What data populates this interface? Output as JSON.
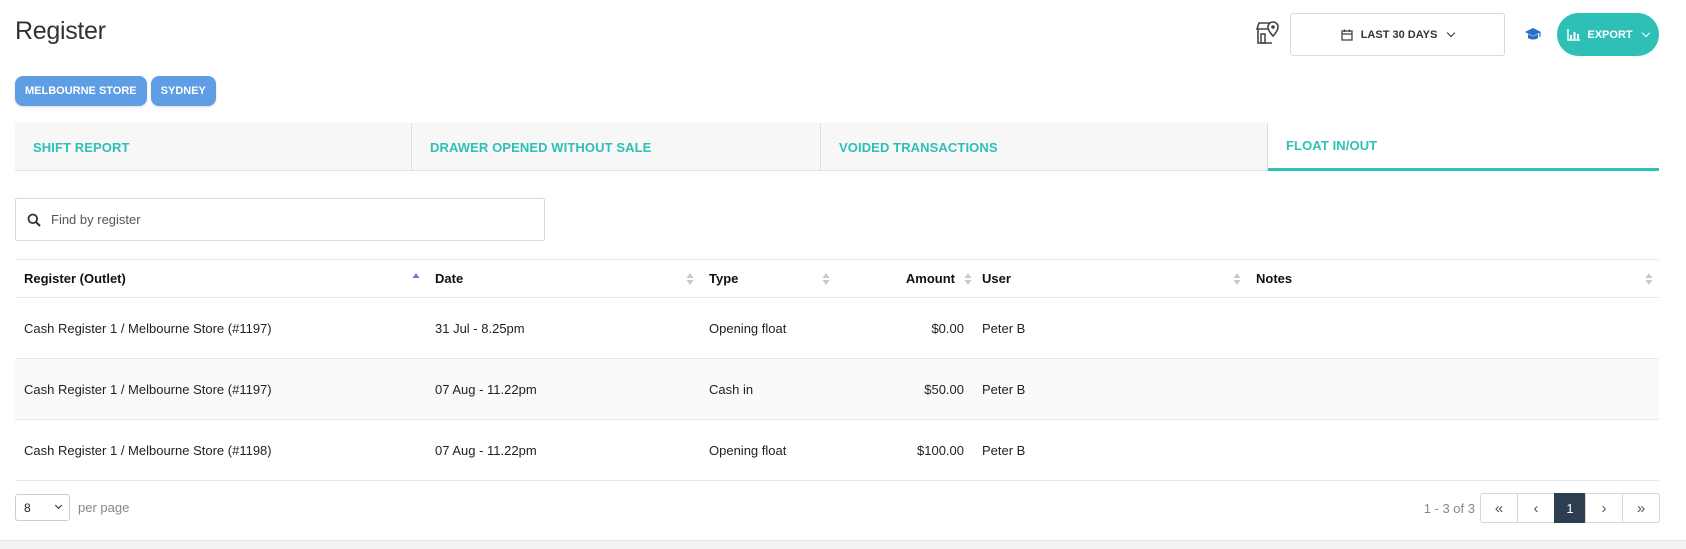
{
  "header": {
    "title": "Register",
    "date_range_label": "LAST 30 DAYS",
    "export_label": "EXPORT",
    "icons": [
      "store-location-icon",
      "calendar-icon",
      "graduation-cap-icon",
      "bar-chart-icon"
    ]
  },
  "outlet_filters": [
    "MELBOURNE STORE",
    "SYDNEY"
  ],
  "tabs": [
    {
      "label": "SHIFT REPORT",
      "active": false
    },
    {
      "label": "DRAWER OPENED WITHOUT SALE",
      "active": false
    },
    {
      "label": "VOIDED TRANSACTIONS",
      "active": false
    },
    {
      "label": "FLOAT IN/OUT",
      "active": true
    }
  ],
  "search": {
    "placeholder": "Find by register",
    "value": ""
  },
  "table": {
    "columns": [
      "Register (Outlet)",
      "Date",
      "Type",
      "Amount",
      "User",
      "Notes"
    ],
    "sorted_column": "Register (Outlet)",
    "sort_direction": "ascending",
    "rows": [
      {
        "register": "Cash Register 1 / Melbourne Store (#1197)",
        "date": "31 Jul - 8.25pm",
        "type": "Opening float",
        "amount": "$0.00",
        "user": "Peter B",
        "notes": ""
      },
      {
        "register": "Cash Register 1 / Melbourne Store (#1197)",
        "date": "07 Aug - 11.22pm",
        "type": "Cash in",
        "amount": "$50.00",
        "user": "Peter B",
        "notes": ""
      },
      {
        "register": "Cash Register 1 / Melbourne Store (#1198)",
        "date": "07 Aug - 11.22pm",
        "type": "Opening float",
        "amount": "$100.00",
        "user": "Peter B",
        "notes": ""
      }
    ]
  },
  "pagination": {
    "per_page_value": "8",
    "per_page_label": "per page",
    "range_text": "1 - 3 of 3",
    "current_page": "1",
    "first": "«",
    "prev": "‹",
    "next": "›",
    "last": "»"
  },
  "colors": {
    "accent": "#2ebfb6",
    "chip": "#5f9ee4",
    "current_page": "#2d3e50",
    "sort_active": "#7b73c9"
  }
}
